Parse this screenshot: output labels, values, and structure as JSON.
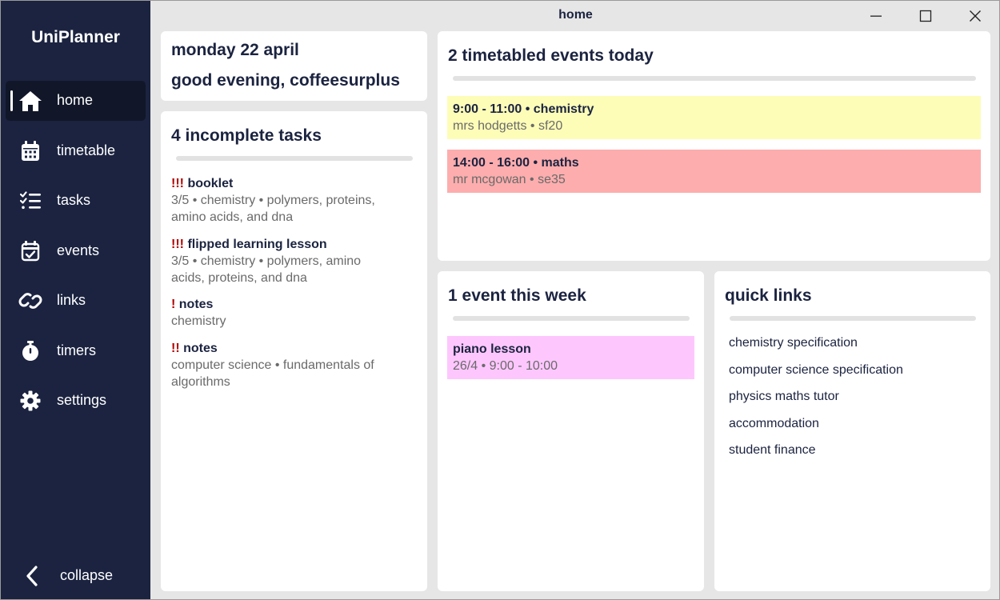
{
  "app": {
    "title": "UniPlanner"
  },
  "window": {
    "title": "home",
    "minimize_icon": "minimize-icon",
    "maximize_icon": "maximize-icon",
    "close_icon": "close-icon"
  },
  "sidebar": {
    "items": [
      {
        "label": "home",
        "icon": "home-icon",
        "active": true
      },
      {
        "label": "timetable",
        "icon": "calendar-grid-icon"
      },
      {
        "label": "tasks",
        "icon": "checklist-icon"
      },
      {
        "label": "events",
        "icon": "calendar-check-icon"
      },
      {
        "label": "links",
        "icon": "link-icon"
      },
      {
        "label": "timers",
        "icon": "stopwatch-icon"
      },
      {
        "label": "settings",
        "icon": "gear-icon"
      }
    ],
    "collapse": {
      "label": "collapse",
      "icon": "chevron-left-icon"
    }
  },
  "greeting": {
    "date": "monday 22 april",
    "message": "good evening, coffeesurplus"
  },
  "tasks": {
    "title": "4 incomplete tasks",
    "items": [
      {
        "priority": "!!!",
        "title": "booklet",
        "detail_lines": [
          "3/5 • chemistry • polymers, proteins,",
          "amino acids, and dna"
        ]
      },
      {
        "priority": "!!!",
        "title": "flipped learning lesson",
        "detail_lines": [
          "3/5 • chemistry • polymers, amino",
          "acids, proteins, and dna"
        ]
      },
      {
        "priority": "!",
        "title": "notes",
        "detail_lines": [
          "chemistry"
        ]
      },
      {
        "priority": "!!",
        "title": "notes",
        "detail_lines": [
          "computer science • fundamentals of",
          "algorithms"
        ]
      }
    ]
  },
  "today": {
    "title": "2 timetabled events today",
    "events": [
      {
        "title": "9:00 - 11:00 • chemistry",
        "detail": "mrs hodgetts • sf20",
        "color": "#fdfdb8"
      },
      {
        "title": "14:00 - 16:00 • maths",
        "detail": "mr mcgowan • se35",
        "color": "#fdadad"
      }
    ]
  },
  "week": {
    "title": "1 event this week",
    "events": [
      {
        "title": "piano lesson",
        "detail": "26/4 • 9:00 - 10:00",
        "color": "#fdc7fd"
      }
    ]
  },
  "quick_links": {
    "title": "quick links",
    "items": [
      "chemistry specification",
      "computer science specification",
      "physics maths tutor",
      "accommodation",
      "student finance"
    ]
  },
  "colors": {
    "sidebar": "#1b2340",
    "sidebar_active": "#111729",
    "priority": "#b00000",
    "text": "#1b2340",
    "muted": "#6a6a6a"
  }
}
